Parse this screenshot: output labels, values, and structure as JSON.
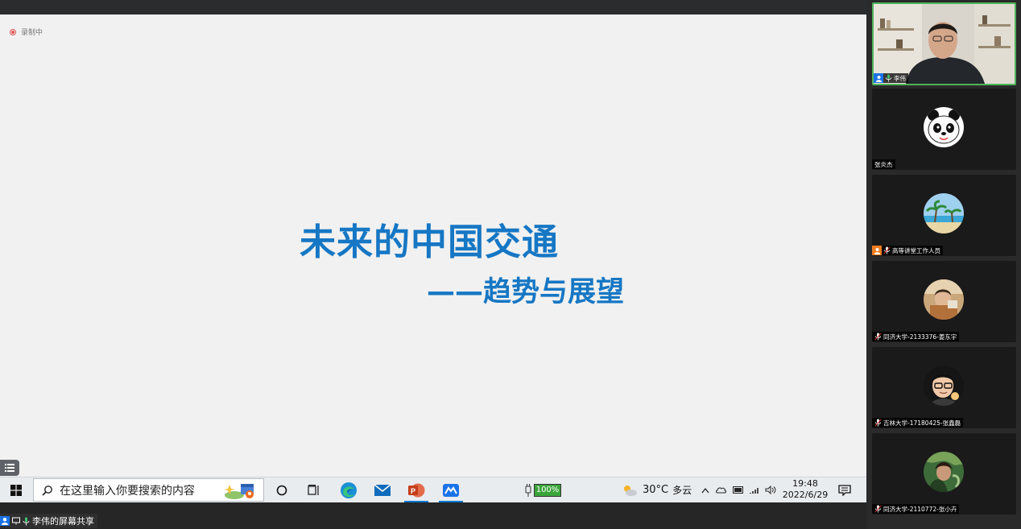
{
  "recording": {
    "label": "录制中"
  },
  "slide": {
    "title": "未来的中国交通",
    "subtitle": "——趋势与展望"
  },
  "taskbar": {
    "search_placeholder": "在这里输入你要搜索的内容",
    "battery": "100%",
    "weather_temp": "30°C",
    "weather_desc": "多云",
    "time": "19:48",
    "date": "2022/6/29"
  },
  "meeting": {
    "share_label": "李伟的屏幕共享"
  },
  "participants": [
    {
      "name": "李伟",
      "active": true
    },
    {
      "name": "张炎杰"
    },
    {
      "name": "高等讲堂工作人员"
    },
    {
      "name": "同济大学-2133376-姜东宇"
    },
    {
      "name": "吉林大学-17180425-张鑫磊"
    },
    {
      "name": "同济大学-2110772-张小卉"
    }
  ],
  "colors": {
    "accent": "#1677c4",
    "active_border": "#4fb45a"
  },
  "icons": [
    "windows-start-icon",
    "search-icon",
    "cortana-icon",
    "task-view-icon",
    "edge-icon",
    "mail-icon",
    "powerpoint-icon",
    "tencent-meeting-icon",
    "battery-icon",
    "weather-icon",
    "chevron-up-icon",
    "onedrive-icon",
    "display-icon",
    "wifi-icon",
    "volume-icon",
    "notification-icon",
    "menu-icon",
    "mic-icon",
    "user-icon",
    "screen-share-icon"
  ]
}
